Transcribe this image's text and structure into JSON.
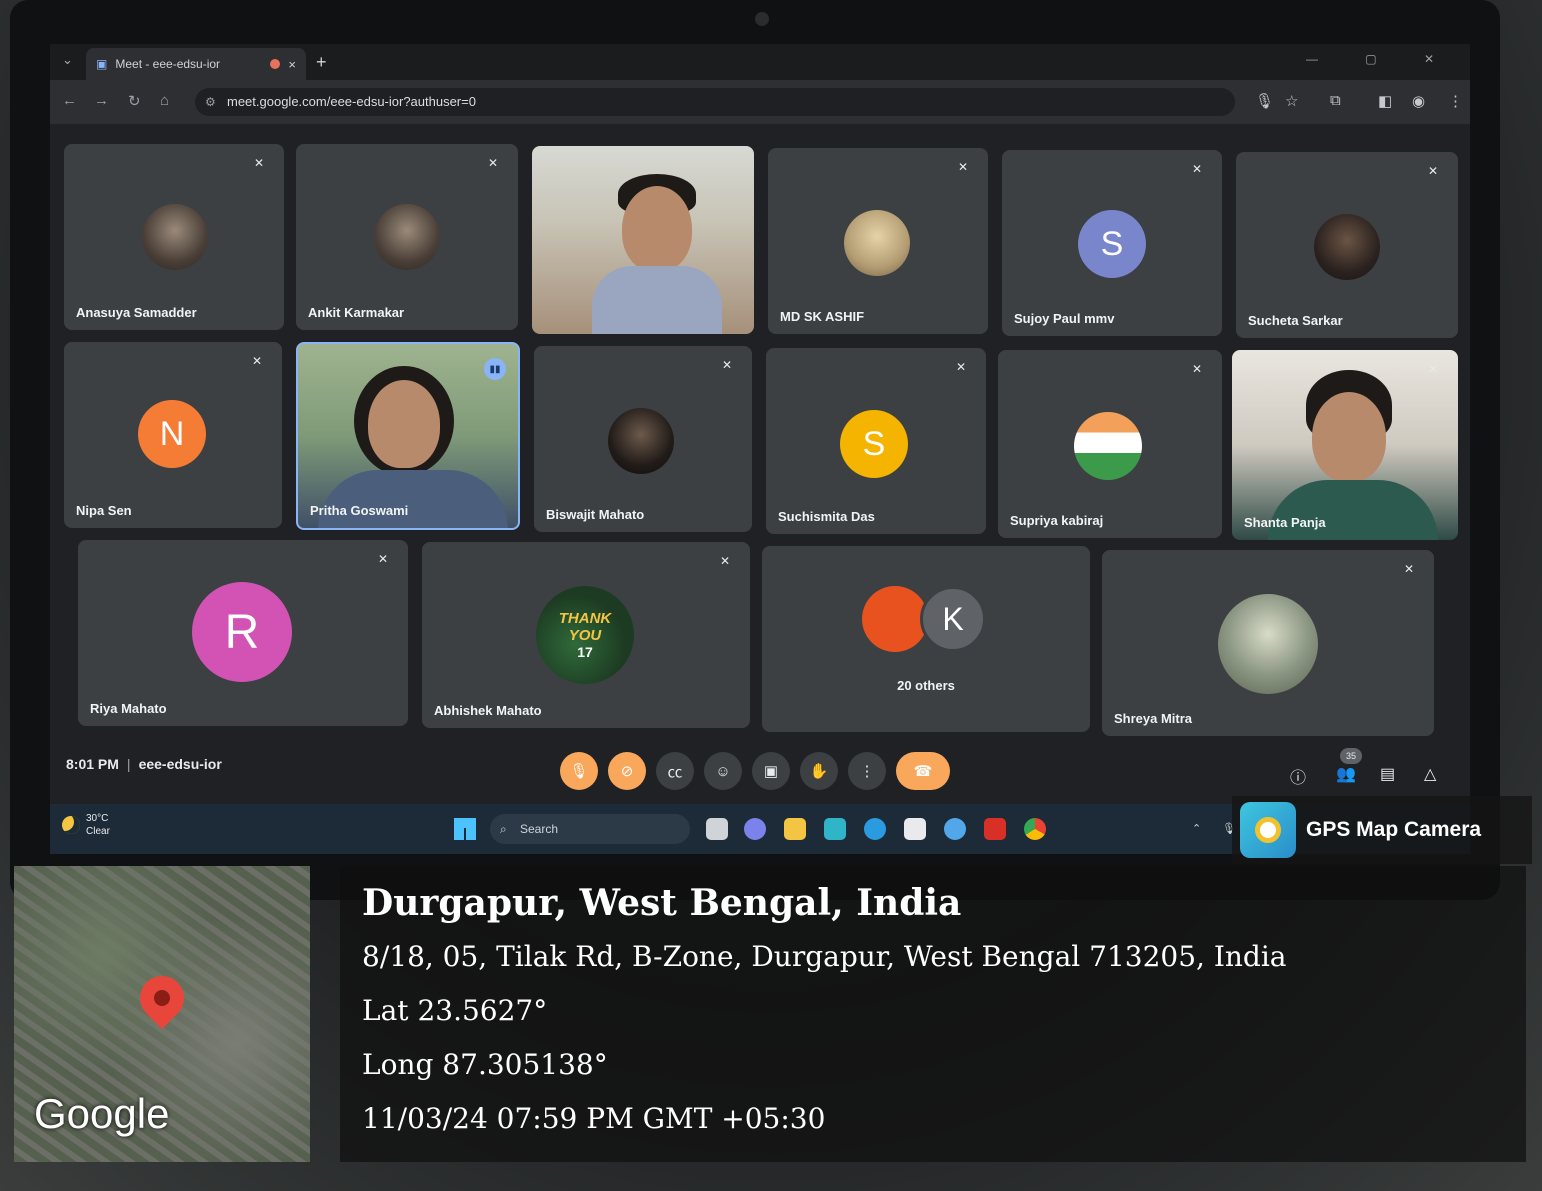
{
  "browser": {
    "tab_title": "Meet - eee-edsu-ior",
    "tab_close": "×",
    "new_tab": "+",
    "url": "meet.google.com/eee-edsu-ior?authuser=0"
  },
  "participants": [
    {
      "name": "Anasuya Samadder",
      "muted": true
    },
    {
      "name": "Ankit Karmakar",
      "muted": true
    },
    {
      "name": "",
      "muted": false
    },
    {
      "name": "MD SK ASHIF",
      "muted": true
    },
    {
      "name": "Sujoy Paul mmv",
      "initial": "S",
      "color": "#7986cb",
      "muted": true
    },
    {
      "name": "Sucheta Sarkar",
      "muted": true
    },
    {
      "name": "Nipa Sen",
      "initial": "N",
      "color": "#f57c35",
      "muted": true
    },
    {
      "name": "Pritha Goswami",
      "speaking": true
    },
    {
      "name": "Biswajit Mahato",
      "muted": true
    },
    {
      "name": "Suchismita Das",
      "initial": "S",
      "color": "#f4b400",
      "muted": true
    },
    {
      "name": "Supriya kabiraj",
      "muted": true
    },
    {
      "name": "Shanta Panja",
      "muted": true
    },
    {
      "name": "Riya Mahato",
      "initial": "R",
      "color": "#d253b4",
      "muted": true
    },
    {
      "name": "Abhishek Mahato",
      "muted": true,
      "avatar_text_1": "THANK",
      "avatar_text_2": "YOU",
      "avatar_text_3": "17"
    },
    {
      "name": "20 others",
      "initial": "K",
      "color": "#5f6368"
    },
    {
      "name": "Shreya Mitra",
      "muted": true
    }
  ],
  "meeting": {
    "time": "8:01 PM",
    "code": "eee-edsu-ior",
    "participant_count": "35"
  },
  "taskbar": {
    "temperature": "30°C",
    "condition": "Clear",
    "search_label": "Search"
  },
  "gps": {
    "app_name": "GPS Map Camera",
    "city": "Durgapur, West Bengal, India",
    "address": "8/18, 05, Tilak Rd, B-Zone, Durgapur, West Bengal 713205, India",
    "lat": "Lat 23.5627°",
    "long": "Long 87.305138°",
    "datetime": "11/03/24 07:59 PM GMT +05:30",
    "map_brand": "Google"
  },
  "colors": {
    "accent_orange": "#f9a85b",
    "speaking_blue": "#8ab4f8",
    "tile_bg": "#3c4043"
  }
}
